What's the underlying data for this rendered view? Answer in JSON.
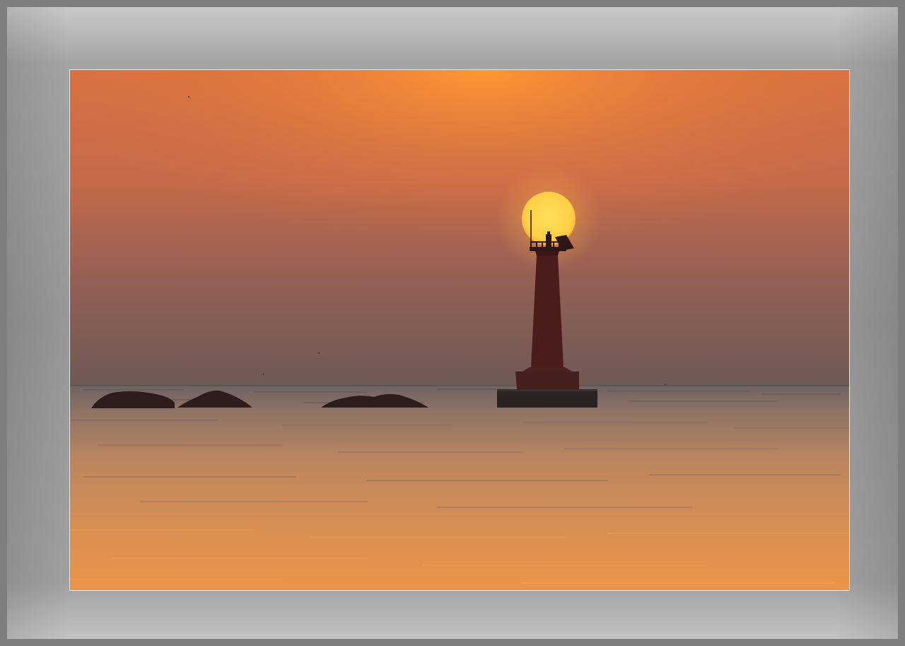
{
  "image": {
    "subject": "lighthouse-sunset",
    "colors": {
      "sky_top": "#d9713f",
      "sky_glow": "#f6953a",
      "sky_mid": "#b9684f",
      "sky_horizon": "#6f5a55",
      "sun": "#ffd24a",
      "sun_edge": "#f7b532",
      "sea_top": "#6d6464",
      "sea_mid": "#c98856",
      "sea_bottom": "#e9944a",
      "silhouette": "#2a1d1c",
      "lighthouse": "#4a1d1a"
    }
  }
}
